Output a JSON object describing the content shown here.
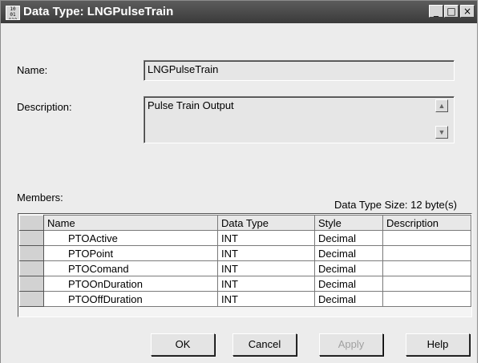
{
  "window": {
    "title": "Data Type: LNGPulseTrain",
    "icon_glyph": "10 01 010",
    "controls": {
      "minimize": "_",
      "maximize": "□",
      "close": "×"
    }
  },
  "form": {
    "name_label": "Name:",
    "name_value": "LNGPulseTrain",
    "description_label": "Description:",
    "description_value": "Pulse Train Output",
    "scroll_up": "▲",
    "scroll_down": "▼"
  },
  "members": {
    "label": "Members:",
    "size_text": "Data Type Size: 12 byte(s)",
    "columns": [
      "Name",
      "Data Type",
      "Style",
      "Description"
    ],
    "rows": [
      {
        "name": "PTOActive",
        "type": "INT",
        "style": "Decimal",
        "description": ""
      },
      {
        "name": "PTOPoint",
        "type": "INT",
        "style": "Decimal",
        "description": ""
      },
      {
        "name": "PTOComand",
        "type": "INT",
        "style": "Decimal",
        "description": ""
      },
      {
        "name": "PTOOnDuration",
        "type": "INT",
        "style": "Decimal",
        "description": ""
      },
      {
        "name": "PTOOffDuration",
        "type": "INT",
        "style": "Decimal",
        "description": ""
      }
    ]
  },
  "buttons": {
    "ok": "OK",
    "cancel": "Cancel",
    "apply": "Apply",
    "help": "Help"
  }
}
